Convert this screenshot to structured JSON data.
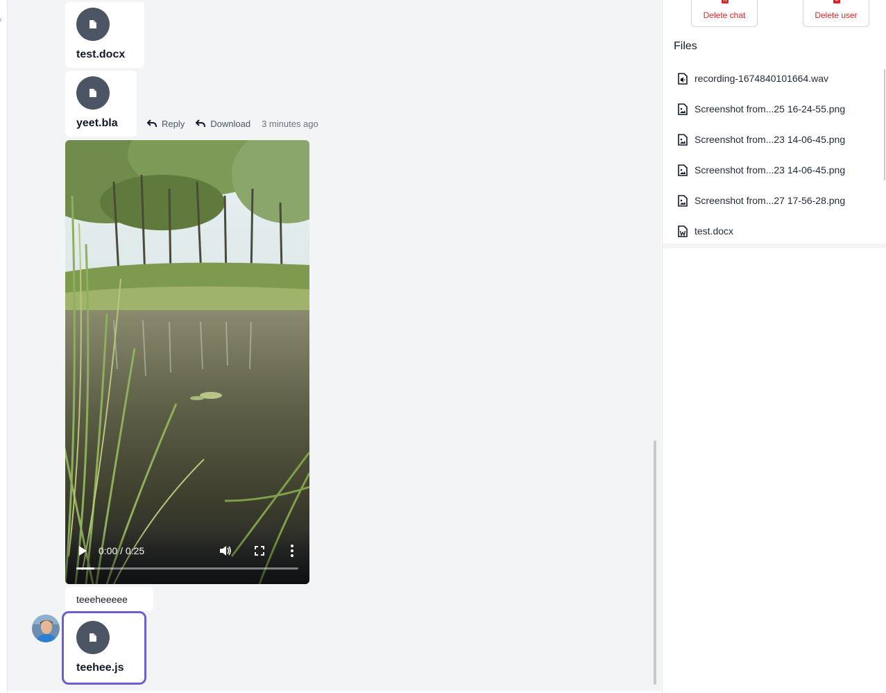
{
  "chat": {
    "messages": [
      {
        "type": "file",
        "name": "test.docx"
      },
      {
        "type": "file",
        "name": "yeet.bla",
        "actions": {
          "reply": "Reply",
          "download": "Download",
          "time": "3 minutes ago"
        }
      },
      {
        "type": "video",
        "time_display": "0:00 / 0:25",
        "progress": 0.08
      },
      {
        "type": "text",
        "text": "teeeheeeee"
      },
      {
        "type": "file",
        "name": "teehee.js",
        "selected": true
      }
    ]
  },
  "sidebar": {
    "delete_chat_label": "Delete chat",
    "delete_user_label": "Delete user",
    "files_title": "Files",
    "files": [
      {
        "name": "recording-1674840101664.wav",
        "icon": "audio-file-icon"
      },
      {
        "name": "Screenshot from...25 16-24-55.png",
        "icon": "image-file-icon"
      },
      {
        "name": "Screenshot from...23 14-06-45.png",
        "icon": "image-file-icon"
      },
      {
        "name": "Screenshot from...23 14-06-45.png",
        "icon": "image-file-icon"
      },
      {
        "name": "Screenshot from...27 17-56-28.png",
        "icon": "image-file-icon"
      },
      {
        "name": "test.docx",
        "icon": "word-file-icon"
      }
    ]
  },
  "colors": {
    "accent": "#6d5dd3",
    "danger": "#dc2626",
    "file_circle": "#4b5563",
    "chat_background": "#f3f4f6"
  }
}
